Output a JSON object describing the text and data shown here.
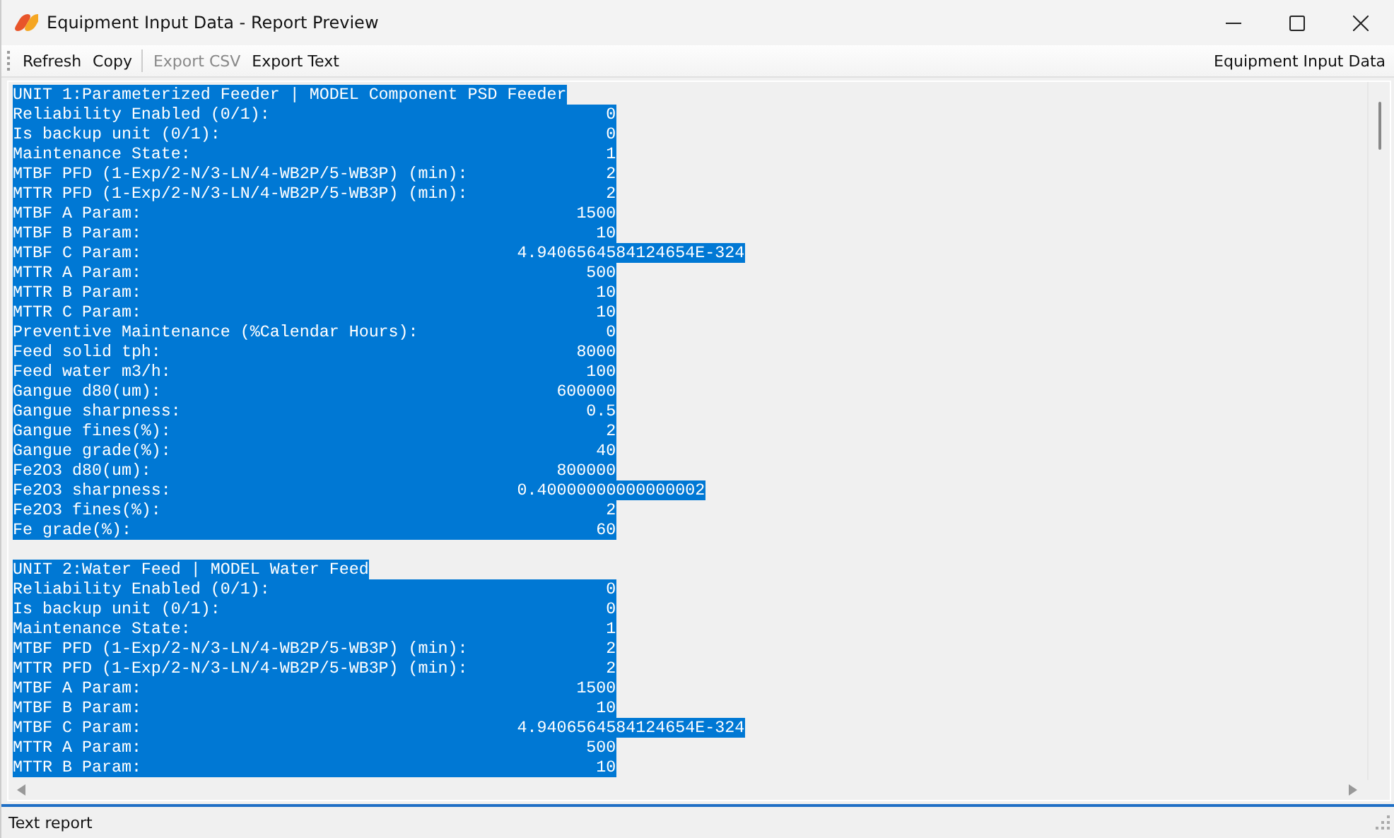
{
  "window": {
    "title": "Equipment Input Data - Report Preview"
  },
  "toolbar": {
    "buttons": [
      {
        "label": "Refresh",
        "disabled": false
      },
      {
        "label": "Copy",
        "disabled": false
      },
      {
        "label": "Export CSV",
        "disabled": true
      },
      {
        "label": "Export Text",
        "disabled": false
      }
    ],
    "caption": "Equipment Input Data"
  },
  "report": {
    "units": [
      {
        "header": "UNIT 1:Parameterized Feeder | MODEL Component PSD Feeder",
        "selected": true,
        "fields": [
          {
            "label": "Reliability Enabled (0/1):",
            "value": "0"
          },
          {
            "label": "Is backup unit (0/1):",
            "value": "0"
          },
          {
            "label": "Maintenance State:",
            "value": "1"
          },
          {
            "label": "MTBF PFD (1-Exp/2-N/3-LN/4-WB2P/5-WB3P) (min):",
            "value": "2"
          },
          {
            "label": "MTTR PFD (1-Exp/2-N/3-LN/4-WB2P/5-WB3P) (min):",
            "value": "2"
          },
          {
            "label": "MTBF A Param:",
            "value": "1500"
          },
          {
            "label": "MTBF B Param:",
            "value": "10"
          },
          {
            "label": "MTBF C Param:",
            "value": "4.9406564584124654E-324"
          },
          {
            "label": "MTTR A Param:",
            "value": "500"
          },
          {
            "label": "MTTR B Param:",
            "value": "10"
          },
          {
            "label": "MTTR C Param:",
            "value": "10"
          },
          {
            "label": "Preventive Maintenance (%Calendar Hours):",
            "value": "0"
          },
          {
            "label": "Feed solid tph:",
            "value": "8000"
          },
          {
            "label": "Feed water m3/h:",
            "value": "100"
          },
          {
            "label": "Gangue d80(um):",
            "value": "600000"
          },
          {
            "label": "Gangue sharpness:",
            "value": "0.5"
          },
          {
            "label": "Gangue fines(%):",
            "value": "2"
          },
          {
            "label": "Gangue grade(%):",
            "value": "40"
          },
          {
            "label": "Fe2O3 d80(um):",
            "value": "800000"
          },
          {
            "label": "Fe2O3 sharpness:",
            "value": "0.40000000000000002"
          },
          {
            "label": "Fe2O3 fines(%):",
            "value": "2"
          },
          {
            "label": "Fe grade(%):",
            "value": "60"
          }
        ]
      },
      {
        "header": "UNIT 2:Water Feed | MODEL Water Feed",
        "selected": true,
        "fields": [
          {
            "label": "Reliability Enabled (0/1):",
            "value": "0"
          },
          {
            "label": "Is backup unit (0/1):",
            "value": "0"
          },
          {
            "label": "Maintenance State:",
            "value": "1"
          },
          {
            "label": "MTBF PFD (1-Exp/2-N/3-LN/4-WB2P/5-WB3P) (min):",
            "value": "2"
          },
          {
            "label": "MTTR PFD (1-Exp/2-N/3-LN/4-WB2P/5-WB3P) (min):",
            "value": "2"
          },
          {
            "label": "MTBF A Param:",
            "value": "1500"
          },
          {
            "label": "MTBF B Param:",
            "value": "10"
          },
          {
            "label": "MTBF C Param:",
            "value": "4.9406564584124654E-324"
          },
          {
            "label": "MTTR A Param:",
            "value": "500"
          },
          {
            "label": "MTTR B Param:",
            "value": "10"
          }
        ]
      }
    ]
  },
  "status_bar": {
    "text": "Text report"
  }
}
